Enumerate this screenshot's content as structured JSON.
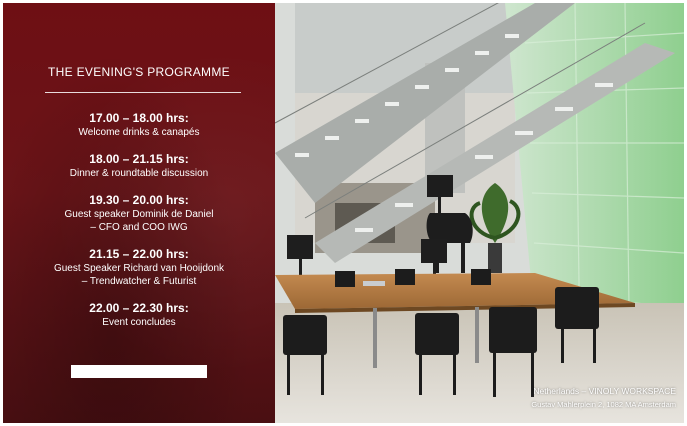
{
  "programme": {
    "title": "THE EVENING'S PROGRAMME",
    "items": [
      {
        "time": "17.00 – 18.00 hrs:",
        "lines": [
          "Welcome drinks & canapés"
        ]
      },
      {
        "time": "18.00 – 21.15 hrs:",
        "lines": [
          "Dinner & roundtable discussion"
        ]
      },
      {
        "time": "19.30 – 20.00 hrs:",
        "lines": [
          "Guest speaker Dominik de Daniel",
          "– CFO and COO IWG"
        ]
      },
      {
        "time": "21.15 – 22.00 hrs:",
        "lines": [
          "Guest Speaker Richard van Hooijdonk",
          "– Trendwatcher & Futurist"
        ]
      },
      {
        "time": "22.00 – 22.30 hrs:",
        "lines": [
          "Event concludes"
        ]
      }
    ]
  },
  "photo": {
    "location": "Netherlands – VINOLY WORKSPACE",
    "address": "Gustav Mahlerplein 2, 1082 MA Amsterdam"
  },
  "colors": {
    "panel": "#6e0f14",
    "glass": "#9ecfa3",
    "wood": "#b27a44"
  }
}
